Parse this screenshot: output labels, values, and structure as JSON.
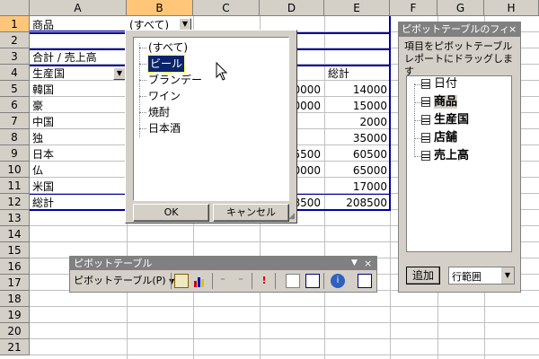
{
  "columns": [
    "A",
    "B",
    "C",
    "D",
    "E",
    "F",
    "G",
    "H"
  ],
  "rows": [
    "1",
    "2",
    "3",
    "4",
    "5",
    "6",
    "7",
    "8",
    "9",
    "10",
    "11",
    "12",
    "13",
    "14",
    "15",
    "16",
    "17",
    "18",
    "19",
    "20",
    "21"
  ],
  "pivot": {
    "page_field_label": "商品",
    "page_field_value": "(すべて)",
    "data_label": "合計 / 売上高",
    "row_field": "生産国",
    "total_header": "総計",
    "row_labels": [
      "韓国",
      "豪",
      "中国",
      "独",
      "日本",
      "仏",
      "米国",
      "総計"
    ],
    "partial_d": [
      "0000",
      "0000",
      "",
      "",
      "5500",
      "0000",
      "",
      "8500"
    ],
    "totals": [
      "14000",
      "15000",
      "2000",
      "35000",
      "60500",
      "65000",
      "17000",
      "208500"
    ]
  },
  "dropdown": {
    "items": [
      "(すべて)",
      "ビール",
      "ブランデー",
      "ワイン",
      "焼酎",
      "日本酒"
    ],
    "selected_index": 1,
    "ok_label": "OK",
    "cancel_label": "キャンセル"
  },
  "pivot_toolbar": {
    "title": "ピボットテーブル",
    "menu_label": "ピボットテーブル(P)",
    "close": "×",
    "icons": [
      "format-report-icon",
      "chart-wizard-icon",
      "hide-detail-icon",
      "show-detail-icon",
      "refresh-icon",
      "include-hidden-icon",
      "always-display-icon",
      "field-settings-icon",
      "field-list-icon"
    ]
  },
  "field_list": {
    "title": "ピボットテーブルのフィ",
    "instruction": "項目をピボットテーブル レポートにドラッグします",
    "fields": [
      {
        "label": "日付",
        "bold": false
      },
      {
        "label": "商品",
        "bold": true
      },
      {
        "label": "生産国",
        "bold": true
      },
      {
        "label": "店舗",
        "bold": true
      },
      {
        "label": "売上高",
        "bold": true
      }
    ],
    "add_button": "追加",
    "area_select": "行範囲"
  }
}
